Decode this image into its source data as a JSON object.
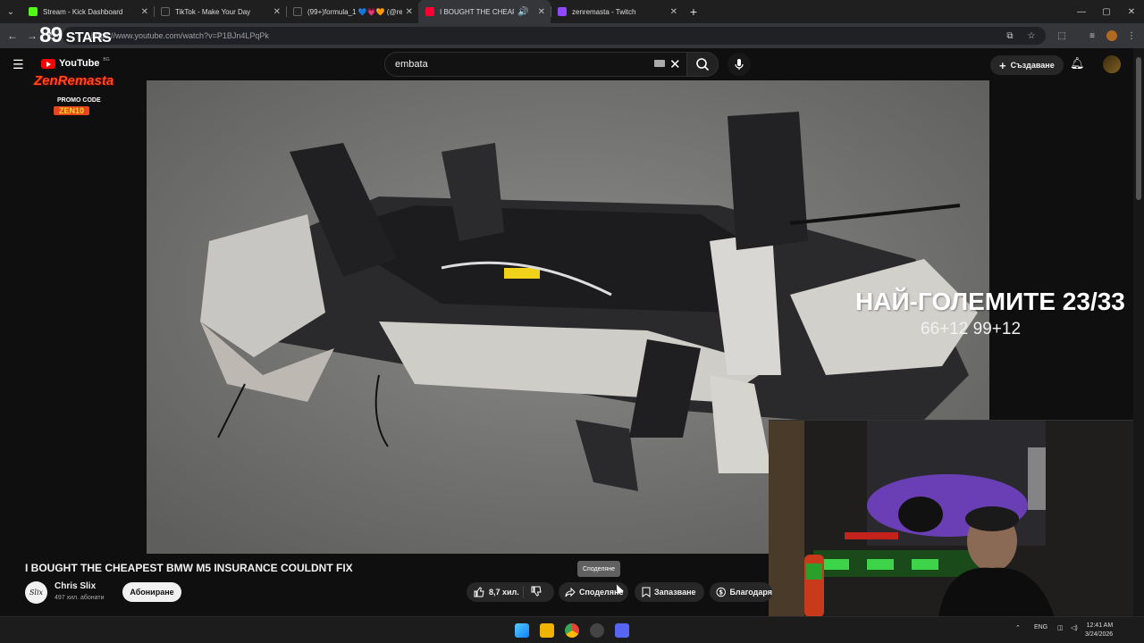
{
  "browser": {
    "tabs": [
      {
        "title": "Stream - Kick Dashboard",
        "favicon_color": "#53fc18",
        "active": false
      },
      {
        "title": "TikTok - Make Your Day",
        "favicon_color": "#222222",
        "active": false
      },
      {
        "title": "(99+)formula_1 💙💗🧡 (@re…",
        "favicon_color": "#222222",
        "active": false
      },
      {
        "title": "I BOUGHT THE CHEAPEST B…",
        "favicon_color": "#ff0033",
        "active": true
      },
      {
        "title": "zenremasta - Twitch",
        "favicon_color": "#9146ff",
        "active": false
      }
    ],
    "url": "https://www.youtube.com/watch?v=P1BJn4LPqPk"
  },
  "youtube": {
    "logo_text": "YouTube",
    "logo_country": "BG",
    "search_value": "embata",
    "create_label": "Създаване"
  },
  "overlay": {
    "stars_number": "89",
    "stars_label": "STARS",
    "brand": "ZenRemasta",
    "promo_label": "PROMO CODE",
    "promo_code": "ZEN10",
    "headline": "НАЙ-ГОЛЕМИТЕ 23/33",
    "subline": "66+12 99+12"
  },
  "video": {
    "title": "I BOUGHT THE CHEAPEST BMW M5 INSURANCE COULDNT FIX",
    "channel": "Chris Slix",
    "subscribers": "497 хил. абонати",
    "subscribe_label": "Абониране",
    "likes": "8,7 хил.",
    "share_label": "Споделяне",
    "share_tooltip": "Споделяне",
    "save_label": "Запазване",
    "thanks_label": "Благодаря"
  },
  "taskbar": {
    "lang": "ENG",
    "time": "12:41 AM",
    "date": "3/24/2026"
  }
}
